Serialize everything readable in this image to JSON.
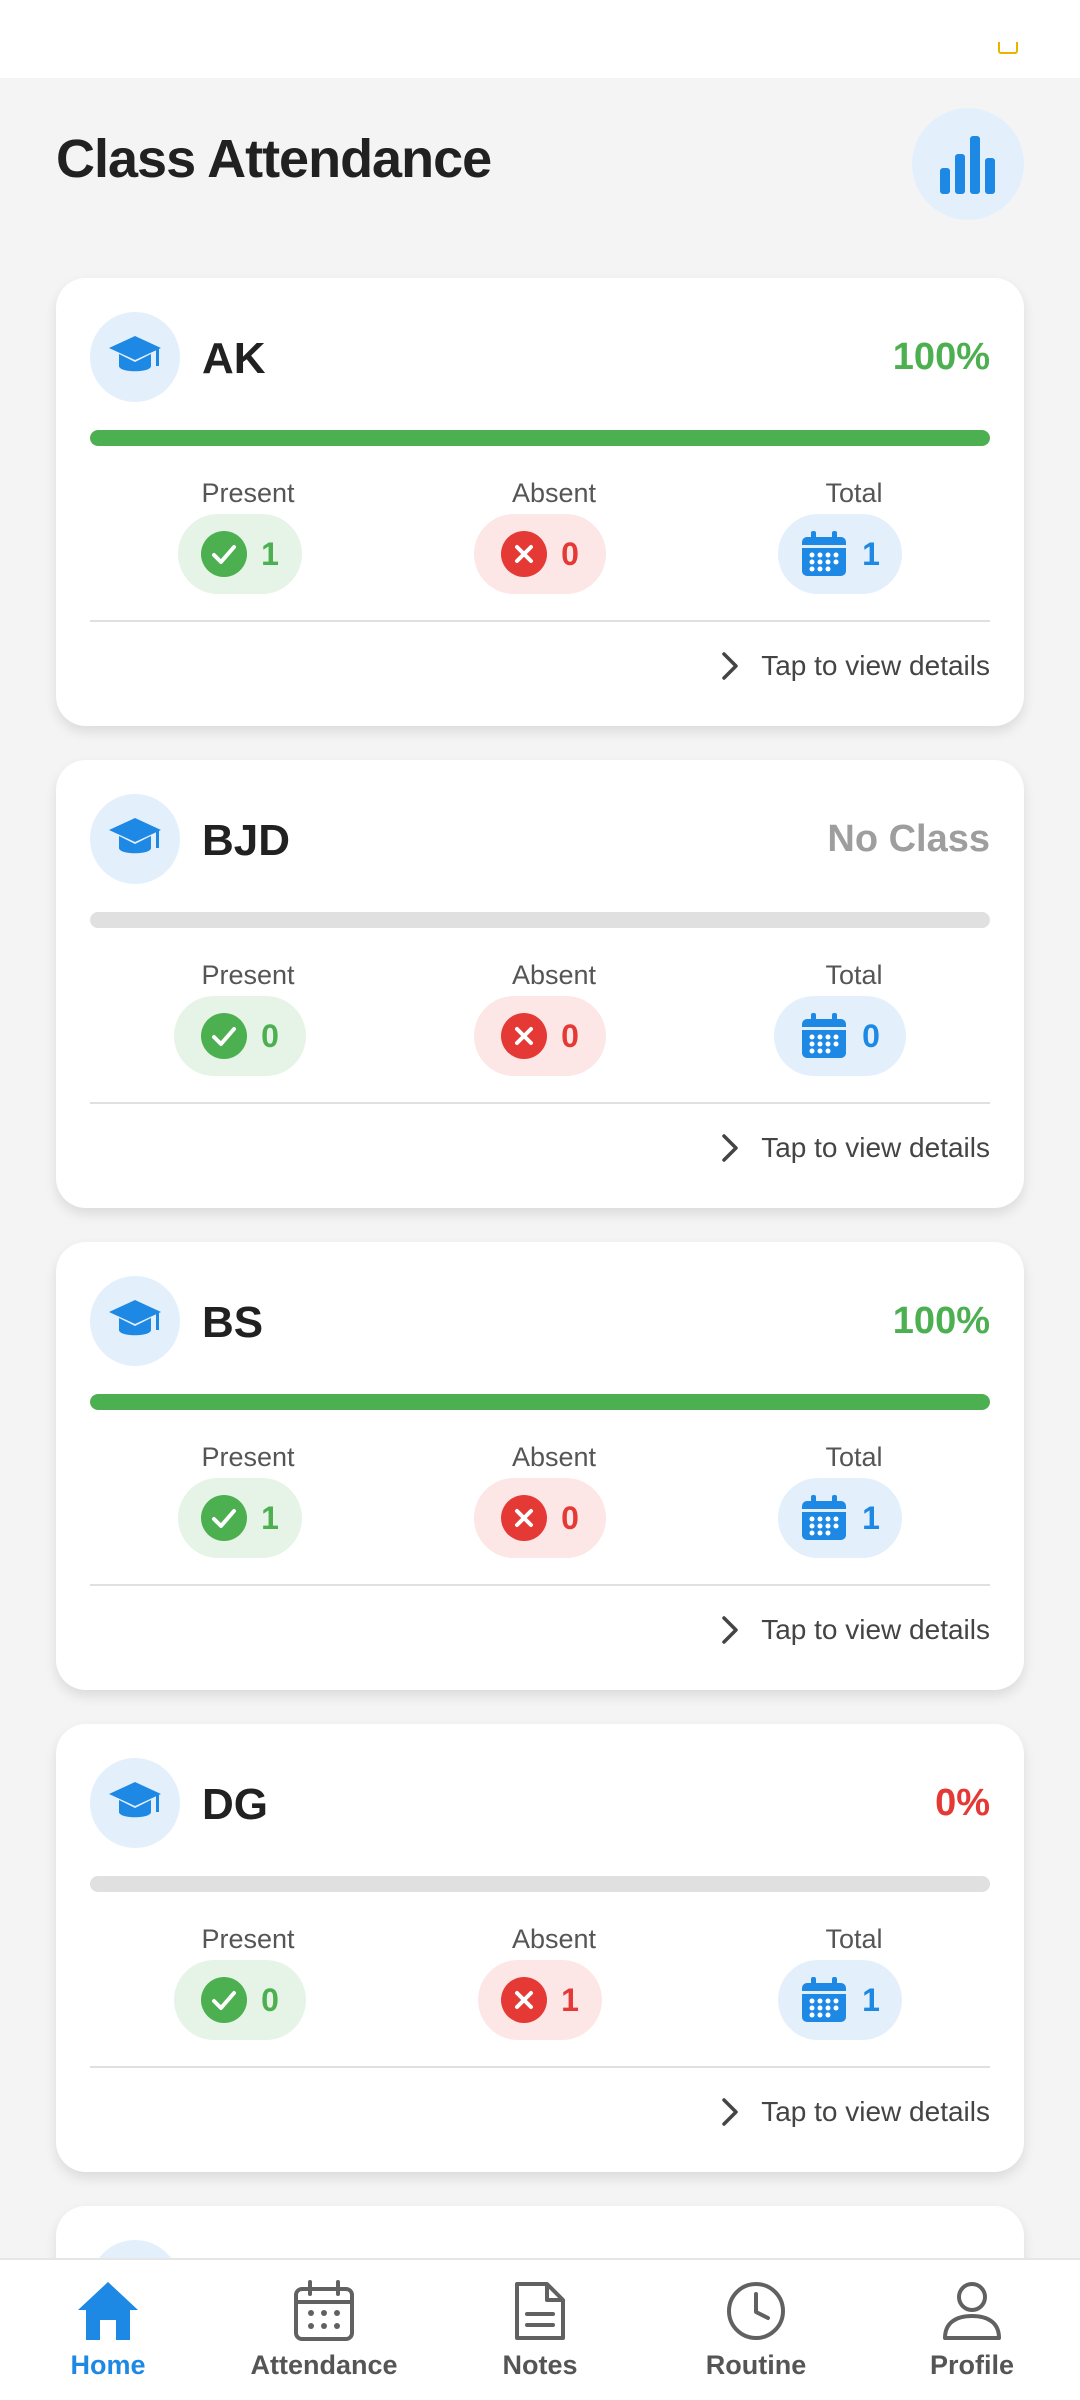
{
  "page": {
    "title": "Class Attendance"
  },
  "labels": {
    "present": "Present",
    "absent": "Absent",
    "total": "Total",
    "details": "Tap to view details"
  },
  "colors": {
    "accent": "#1e88e5",
    "success": "#4caf50",
    "danger": "#e53935",
    "muted": "#9e9e9e"
  },
  "classes": [
    {
      "name": "AK",
      "status": "100%",
      "attendance_fraction": 1.0,
      "present": "1",
      "absent": "0",
      "total": "1"
    },
    {
      "name": "BJD",
      "status": "No Class",
      "attendance_fraction": 0.0,
      "present": "0",
      "absent": "0",
      "total": "0"
    },
    {
      "name": "BS",
      "status": "100%",
      "attendance_fraction": 1.0,
      "present": "1",
      "absent": "0",
      "total": "1"
    },
    {
      "name": "DG",
      "status": "0%",
      "attendance_fraction": 0.0,
      "present": "0",
      "absent": "1",
      "total": "1"
    }
  ],
  "nav": {
    "home": "Home",
    "attendance": "Attendance",
    "notes": "Notes",
    "routine": "Routine",
    "profile": "Profile",
    "active": "home"
  }
}
